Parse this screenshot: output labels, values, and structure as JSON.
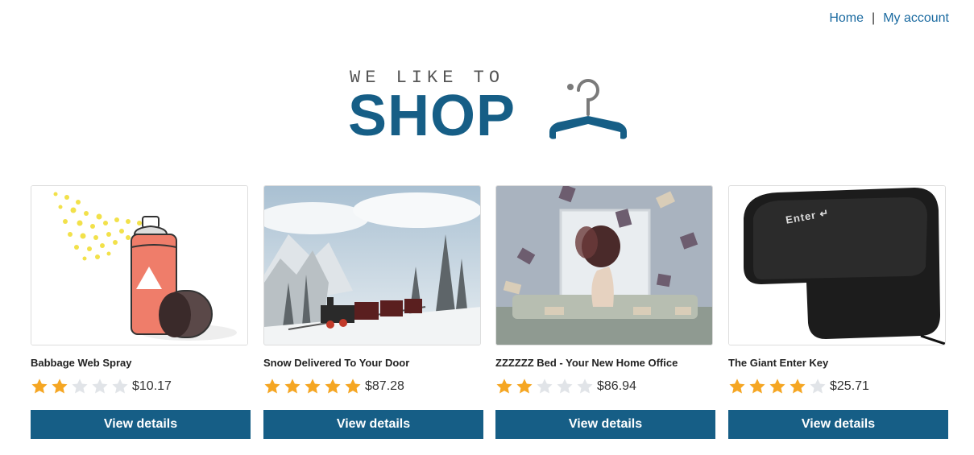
{
  "nav": {
    "home_label": "Home",
    "separator": "|",
    "account_label": "My account"
  },
  "logo": {
    "tagline": "WE LIKE TO",
    "word": "SHOP",
    "brand_color": "#165e86"
  },
  "products": [
    {
      "name": "Babbage Web Spray",
      "rating": 2,
      "max_rating": 5,
      "price": "$10.17",
      "button_label": "View details",
      "image": "spray-can-image"
    },
    {
      "name": "Snow Delivered To Your Door",
      "rating": 5,
      "max_rating": 5,
      "price": "$87.28",
      "button_label": "View details",
      "image": "snow-train-image"
    },
    {
      "name": "ZZZZZZ Bed - Your New Home Office",
      "rating": 2,
      "max_rating": 5,
      "price": "$86.94",
      "button_label": "View details",
      "image": "bed-books-image"
    },
    {
      "name": "The Giant Enter Key",
      "rating": 4,
      "max_rating": 5,
      "price": "$25.71",
      "button_label": "View details",
      "image": "enter-key-image"
    }
  ],
  "colors": {
    "star_filled": "#f5a623",
    "star_empty": "#e1e4e8",
    "button_bg": "#165e86",
    "link": "#1a6aa0"
  }
}
